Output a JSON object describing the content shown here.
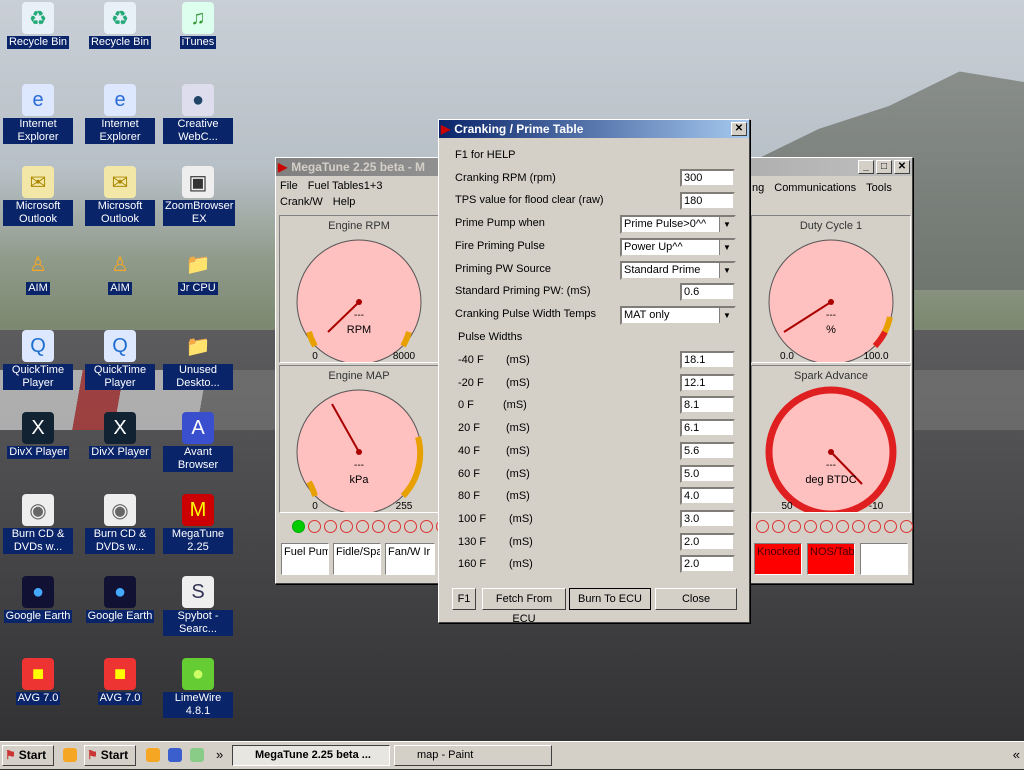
{
  "desktop": {
    "icons": [
      {
        "label": "Recycle Bin",
        "icon": "recycle-bin-icon"
      },
      {
        "label": "Recycle Bin",
        "icon": "recycle-bin-icon"
      },
      {
        "label": "iTunes",
        "icon": "itunes-icon"
      },
      {
        "label": "Internet Explorer",
        "icon": "internet-explorer-icon"
      },
      {
        "label": "Internet Explorer",
        "icon": "internet-explorer-icon"
      },
      {
        "label": "Creative WebC...",
        "icon": "webcam-icon"
      },
      {
        "label": "Microsoft Outlook",
        "icon": "outlook-icon"
      },
      {
        "label": "Microsoft Outlook",
        "icon": "outlook-icon"
      },
      {
        "label": "ZoomBrowser EX",
        "icon": "camera-icon"
      },
      {
        "label": "AIM",
        "icon": "aim-icon"
      },
      {
        "label": "AIM",
        "icon": "aim-icon"
      },
      {
        "label": "Jr CPU",
        "icon": "folder-icon"
      },
      {
        "label": "QuickTime Player",
        "icon": "quicktime-icon"
      },
      {
        "label": "QuickTime Player",
        "icon": "quicktime-icon"
      },
      {
        "label": "Unused Deskto...",
        "icon": "folder-icon"
      },
      {
        "label": "DivX Player",
        "icon": "divx-icon"
      },
      {
        "label": "DivX Player",
        "icon": "divx-icon"
      },
      {
        "label": "Avant Browser",
        "icon": "avant-browser-icon"
      },
      {
        "label": "Burn CD & DVDs w...",
        "icon": "burn-cd-icon"
      },
      {
        "label": "Burn CD & DVDs w...",
        "icon": "burn-cd-icon"
      },
      {
        "label": "MegaTune 2.25",
        "icon": "megatune-icon"
      },
      {
        "label": "Google Earth",
        "icon": "google-earth-icon"
      },
      {
        "label": "Google Earth",
        "icon": "google-earth-icon"
      },
      {
        "label": "Spybot - Searc...",
        "icon": "spybot-icon"
      },
      {
        "label": "AVG 7.0",
        "icon": "avg-icon"
      },
      {
        "label": "AVG 7.0",
        "icon": "avg-icon"
      },
      {
        "label": "LimeWire 4.8.1",
        "icon": "limewire-icon"
      }
    ]
  },
  "megatune": {
    "title": "MegaTune 2.25 beta - M",
    "menu": [
      "File",
      "Fuel Tables1+3",
      "Crank/W",
      "ng",
      "Communications",
      "Tools",
      "Help"
    ],
    "gauges": [
      {
        "title": "Engine RPM",
        "unit": "RPM",
        "value": "---",
        "min": "0",
        "max": "8000"
      },
      {
        "title": "Engine MAP",
        "unit": "kPa",
        "value": "---",
        "min": "0",
        "max": "255"
      },
      {
        "title": "Duty Cycle 1",
        "unit": "%",
        "value": "---",
        "min": "0.0",
        "max": "100.0"
      },
      {
        "title": "Spark Advance",
        "unit": "deg BTDC",
        "value": "---",
        "min": "50",
        "max": "-10"
      }
    ],
    "status_left": [
      "Fuel Pum",
      "Fidle/Spa",
      "Fan/W Ir"
    ],
    "status_right": [
      "Knocked",
      "NOS/Tab",
      ""
    ]
  },
  "dialog": {
    "title": "Cranking / Prime Table",
    "help": "F1 for HELP",
    "cranking_rpm_label": "Cranking RPM (rpm)",
    "cranking_rpm_value": "300",
    "tps_label": "TPS value for flood clear (raw)",
    "tps_value": "180",
    "prime_pump_label": "Prime Pump when",
    "prime_pump_value": "Prime Pulse>0^^",
    "fire_priming_label": "Fire Priming Pulse",
    "fire_priming_value": "Power Up^^",
    "priming_pw_source_label": "Priming PW Source",
    "priming_pw_source_value": "Standard Prime",
    "std_priming_pw_label": "Standard Priming PW: (mS)",
    "std_priming_pw_value": "0.6",
    "cranking_temps_label": "Cranking Pulse Width Temps",
    "cranking_temps_value": "MAT only",
    "pulse_widths_label": "Pulse Widths",
    "pulse_rows": [
      {
        "temp": "-40 F",
        "unit": "(mS)",
        "value": "18.1"
      },
      {
        "temp": "-20 F",
        "unit": "(mS)",
        "value": "12.1"
      },
      {
        "temp": "0  F",
        "unit": "(mS)",
        "value": "8.1"
      },
      {
        "temp": "20 F",
        "unit": "(mS)",
        "value": "6.1"
      },
      {
        "temp": "40 F",
        "unit": "(mS)",
        "value": "5.6"
      },
      {
        "temp": "60 F",
        "unit": "(mS)",
        "value": "5.0"
      },
      {
        "temp": "80 F",
        "unit": "(mS)",
        "value": "4.0"
      },
      {
        "temp": "100 F",
        "unit": "(mS)",
        "value": "3.0"
      },
      {
        "temp": "130 F",
        "unit": "(mS)",
        "value": "2.0"
      },
      {
        "temp": "160 F",
        "unit": "(mS)",
        "value": "2.0"
      }
    ],
    "buttons": {
      "f1": "F1",
      "fetch": "Fetch From ECU",
      "burn": "Burn To ECU",
      "close": "Close"
    }
  },
  "taskbar": {
    "start1": "Start",
    "start2": "Start",
    "items": [
      "MegaTune 2.25 beta ...",
      "map - Paint"
    ],
    "chevron": "»",
    "right_chevron": "«"
  }
}
